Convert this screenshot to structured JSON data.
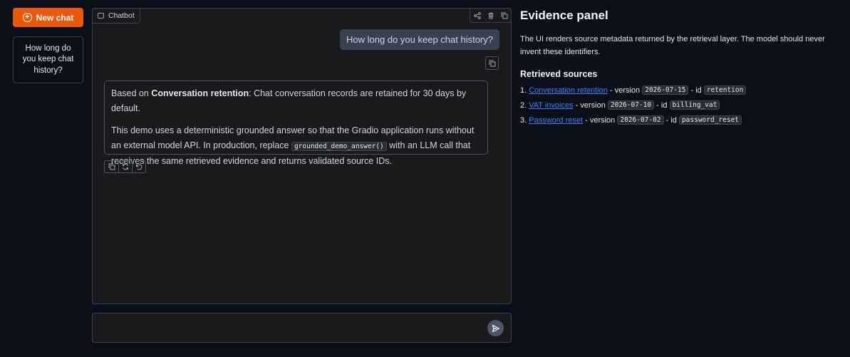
{
  "sidebar": {
    "new_chat_label": "New chat",
    "history": [
      {
        "label": "How long do you keep chat history?"
      }
    ]
  },
  "chatbot": {
    "label": "Chatbot",
    "icons": [
      "share-icon",
      "trash-icon",
      "copy-icon"
    ],
    "messages": {
      "user": "How long do you keep chat history?",
      "bot": {
        "p1_prefix": "Based on ",
        "p1_bold": "Conversation retention",
        "p1_rest": ": Chat conversation records are retained for 30 days by default.",
        "p2_part1": "This demo uses a deterministic grounded answer so that the Gradio application runs without an external model API. In production, replace ",
        "p2_code": "grounded_demo_answer()",
        "p2_part2": " with an LLM call that receives the same retrieved evidence and returns validated source IDs."
      }
    }
  },
  "input": {
    "value": "",
    "placeholder": ""
  },
  "evidence": {
    "title": "Evidence panel",
    "description": "The UI renders source metadata returned by the retrieval layer. The model should never invent these identifiers.",
    "sources_heading": "Retrieved sources",
    "sources": [
      {
        "num": "1. ",
        "title": "Conversation retention",
        "ver_label": " - version ",
        "version": "2026-07-15",
        "id_label": " - id ",
        "id": "retention"
      },
      {
        "num": "2. ",
        "title": "VAT invoices",
        "ver_label": " - version ",
        "version": "2026-07-10",
        "id_label": " - id ",
        "id": "billing_vat"
      },
      {
        "num": "3. ",
        "title": "Password reset",
        "ver_label": " - version ",
        "version": "2026-07-02",
        "id_label": " - id ",
        "id": "password_reset"
      }
    ]
  },
  "colors": {
    "accent": "#ea580c",
    "link": "#3b82f6",
    "background": "#0b0f19"
  }
}
